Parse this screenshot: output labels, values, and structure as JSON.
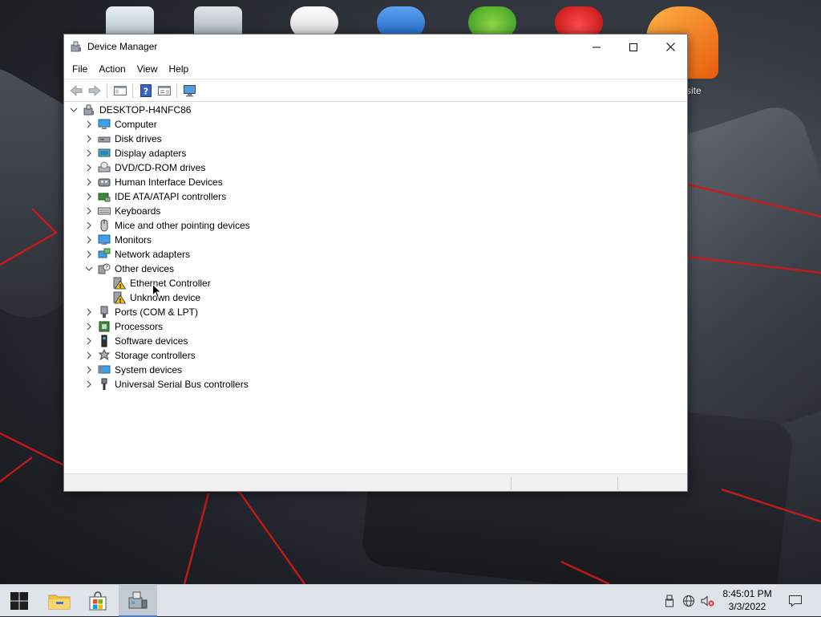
{
  "desktop": {
    "partial_icon_label": "site"
  },
  "window": {
    "title": "Device Manager",
    "menu": [
      "File",
      "Action",
      "View",
      "Help"
    ]
  },
  "tree": {
    "root": "DESKTOP-H4NFC86",
    "categories": [
      {
        "label": "Computer",
        "icon": "computer-icon",
        "expanded": false
      },
      {
        "label": "Disk drives",
        "icon": "disk-drive-icon",
        "expanded": false
      },
      {
        "label": "Display adapters",
        "icon": "display-adapter-icon",
        "expanded": false
      },
      {
        "label": "DVD/CD-ROM drives",
        "icon": "dvd-drive-icon",
        "expanded": false
      },
      {
        "label": "Human Interface Devices",
        "icon": "hid-icon",
        "expanded": false
      },
      {
        "label": "IDE ATA/ATAPI controllers",
        "icon": "ide-controller-icon",
        "expanded": false
      },
      {
        "label": "Keyboards",
        "icon": "keyboard-icon",
        "expanded": false
      },
      {
        "label": "Mice and other pointing devices",
        "icon": "mouse-icon",
        "expanded": false
      },
      {
        "label": "Monitors",
        "icon": "monitor-icon",
        "expanded": false
      },
      {
        "label": "Network adapters",
        "icon": "network-adapter-icon",
        "expanded": false
      },
      {
        "label": "Other devices",
        "icon": "other-devices-icon",
        "expanded": true,
        "children": [
          {
            "label": "Ethernet Controller",
            "icon": "warning-device-icon"
          },
          {
            "label": "Unknown device",
            "icon": "warning-device-icon"
          }
        ]
      },
      {
        "label": "Ports (COM & LPT)",
        "icon": "port-icon",
        "expanded": false
      },
      {
        "label": "Processors",
        "icon": "processor-icon",
        "expanded": false
      },
      {
        "label": "Software devices",
        "icon": "software-device-icon",
        "expanded": false
      },
      {
        "label": "Storage controllers",
        "icon": "storage-controller-icon",
        "expanded": false
      },
      {
        "label": "System devices",
        "icon": "system-devices-icon",
        "expanded": false
      },
      {
        "label": "Universal Serial Bus controllers",
        "icon": "usb-icon",
        "expanded": false
      }
    ]
  },
  "taskbar": {
    "time": "8:45:01 PM",
    "date": "3/3/2022"
  },
  "colors": {
    "accent": "#4a7cc4",
    "warning": "#f4c20d",
    "taskbar_bg": "#dfe3ea"
  }
}
